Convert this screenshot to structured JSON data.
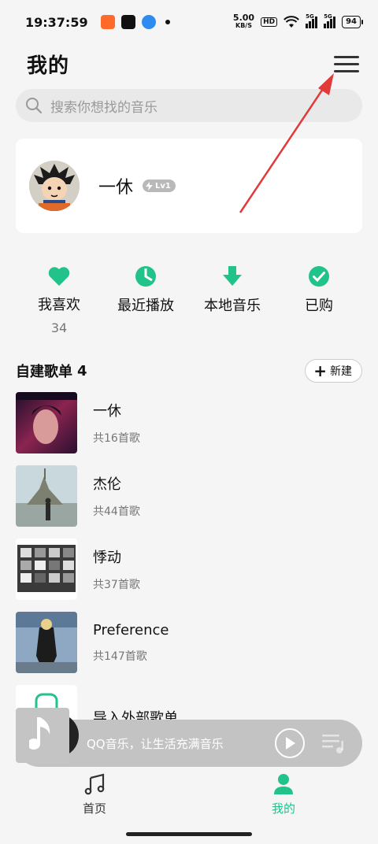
{
  "status_bar": {
    "time": "19:37:59",
    "net_speed": "5.00",
    "net_unit": "KB/S",
    "hd": "HD",
    "sig1": "5G",
    "sig2": "5G",
    "battery": "94"
  },
  "header": {
    "title": "我的"
  },
  "search": {
    "placeholder": "搜索你想找的音乐"
  },
  "profile": {
    "name": "一休",
    "level": "Lv1"
  },
  "quick_actions": [
    {
      "label": "我喜欢",
      "count": "34",
      "icon": "heart-icon"
    },
    {
      "label": "最近播放",
      "icon": "clock-icon"
    },
    {
      "label": "本地音乐",
      "icon": "download-icon"
    },
    {
      "label": "已购",
      "icon": "check-circle-icon"
    }
  ],
  "playlists_section": {
    "title": "自建歌单",
    "count": "4",
    "new_label": "新建"
  },
  "playlists": [
    {
      "name": "一休",
      "count": "共16首歌"
    },
    {
      "name": "杰伦",
      "count": "共44首歌"
    },
    {
      "name": "悸动",
      "count": "共37首歌"
    },
    {
      "name": "Preference",
      "count": "共147首歌"
    },
    {
      "name": "导入外部歌单"
    }
  ],
  "mini_player": {
    "text": "QQ音乐，让生活充满音乐"
  },
  "bottom_nav": {
    "home": "首页",
    "mine": "我的"
  },
  "colors": {
    "accent": "#21c38a",
    "annotation": "#e03a3a"
  }
}
